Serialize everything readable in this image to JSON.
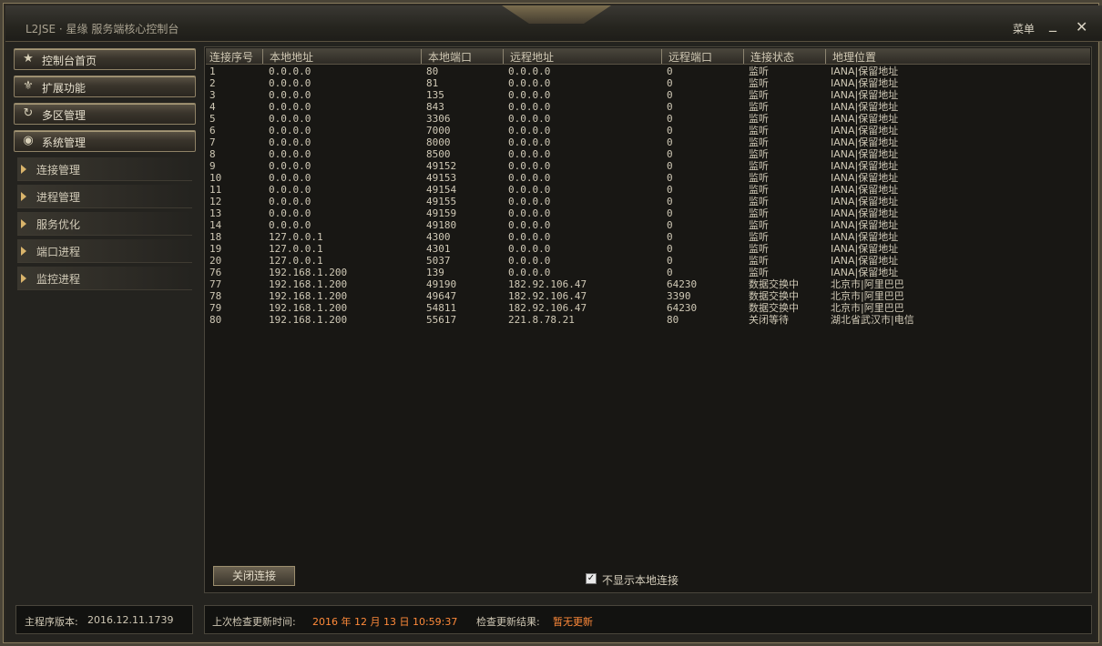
{
  "window": {
    "title": "L2JSE · 星缘 服务端核心控制台",
    "menu_label": "菜单",
    "minimize": "_",
    "close": "✕"
  },
  "sidebar": {
    "main_items": [
      {
        "label": "控制台首页",
        "icon": "star-icon",
        "glyph": "★"
      },
      {
        "label": "扩展功能",
        "icon": "fleur-icon",
        "glyph": "⚜"
      },
      {
        "label": "多区管理",
        "icon": "cycle-icon",
        "glyph": "↻"
      },
      {
        "label": "系统管理",
        "icon": "eye-icon",
        "glyph": "◉"
      }
    ],
    "sub_items": [
      {
        "label": "连接管理"
      },
      {
        "label": "进程管理"
      },
      {
        "label": "服务优化"
      },
      {
        "label": "端口进程"
      },
      {
        "label": "监控进程"
      }
    ]
  },
  "version": {
    "label": "主程序版本:",
    "value": "2016.12.11.1739"
  },
  "table": {
    "columns": [
      "连接序号",
      "本地地址",
      "本地端口",
      "远程地址",
      "远程端口",
      "连接状态",
      "地理位置"
    ],
    "rows": [
      [
        "1",
        "0.0.0.0",
        "80",
        "0.0.0.0",
        "0",
        "监听",
        "IANA|保留地址"
      ],
      [
        "2",
        "0.0.0.0",
        "81",
        "0.0.0.0",
        "0",
        "监听",
        "IANA|保留地址"
      ],
      [
        "3",
        "0.0.0.0",
        "135",
        "0.0.0.0",
        "0",
        "监听",
        "IANA|保留地址"
      ],
      [
        "4",
        "0.0.0.0",
        "843",
        "0.0.0.0",
        "0",
        "监听",
        "IANA|保留地址"
      ],
      [
        "5",
        "0.0.0.0",
        "3306",
        "0.0.0.0",
        "0",
        "监听",
        "IANA|保留地址"
      ],
      [
        "6",
        "0.0.0.0",
        "7000",
        "0.0.0.0",
        "0",
        "监听",
        "IANA|保留地址"
      ],
      [
        "7",
        "0.0.0.0",
        "8000",
        "0.0.0.0",
        "0",
        "监听",
        "IANA|保留地址"
      ],
      [
        "8",
        "0.0.0.0",
        "8500",
        "0.0.0.0",
        "0",
        "监听",
        "IANA|保留地址"
      ],
      [
        "9",
        "0.0.0.0",
        "49152",
        "0.0.0.0",
        "0",
        "监听",
        "IANA|保留地址"
      ],
      [
        "10",
        "0.0.0.0",
        "49153",
        "0.0.0.0",
        "0",
        "监听",
        "IANA|保留地址"
      ],
      [
        "11",
        "0.0.0.0",
        "49154",
        "0.0.0.0",
        "0",
        "监听",
        "IANA|保留地址"
      ],
      [
        "12",
        "0.0.0.0",
        "49155",
        "0.0.0.0",
        "0",
        "监听",
        "IANA|保留地址"
      ],
      [
        "13",
        "0.0.0.0",
        "49159",
        "0.0.0.0",
        "0",
        "监听",
        "IANA|保留地址"
      ],
      [
        "14",
        "0.0.0.0",
        "49180",
        "0.0.0.0",
        "0",
        "监听",
        "IANA|保留地址"
      ],
      [
        "18",
        "127.0.0.1",
        "4300",
        "0.0.0.0",
        "0",
        "监听",
        "IANA|保留地址"
      ],
      [
        "19",
        "127.0.0.1",
        "4301",
        "0.0.0.0",
        "0",
        "监听",
        "IANA|保留地址"
      ],
      [
        "20",
        "127.0.0.1",
        "5037",
        "0.0.0.0",
        "0",
        "监听",
        "IANA|保留地址"
      ],
      [
        "76",
        "192.168.1.200",
        "139",
        "0.0.0.0",
        "0",
        "监听",
        "IANA|保留地址"
      ],
      [
        "77",
        "192.168.1.200",
        "49190",
        "182.92.106.47",
        "64230",
        "数据交换中",
        "北京市|阿里巴巴"
      ],
      [
        "78",
        "192.168.1.200",
        "49647",
        "182.92.106.47",
        "3390",
        "数据交换中",
        "北京市|阿里巴巴"
      ],
      [
        "79",
        "192.168.1.200",
        "54811",
        "182.92.106.47",
        "64230",
        "数据交换中",
        "北京市|阿里巴巴"
      ],
      [
        "80",
        "192.168.1.200",
        "55617",
        "221.8.78.21",
        "80",
        "关闭等待",
        "湖北省武汉市|电信"
      ]
    ]
  },
  "actions": {
    "close_conn_label": "关闭连接",
    "hide_local_label": "不显示本地连接",
    "hide_local_checked": true
  },
  "status": {
    "last_check_label": "上次检查更新时间:",
    "last_check_value": "2016 年 12 月 13 日 10:59:37",
    "result_label": "检查更新结果:",
    "result_value": "暂无更新"
  }
}
